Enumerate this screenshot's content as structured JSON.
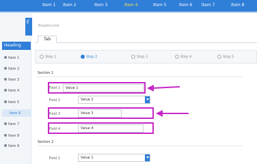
{
  "topnav": {
    "items": [
      {
        "label": "Item 1"
      },
      {
        "label": "Item 2"
      },
      {
        "label": "Item 3"
      },
      {
        "label": "Item 4"
      },
      {
        "label": "Item 5"
      },
      {
        "label": "Item 6"
      },
      {
        "label": "Item 7"
      },
      {
        "label": "Item 8"
      }
    ],
    "active_index": 3
  },
  "sidebar": {
    "tab_label": "Tab",
    "heading": "Heading",
    "items": [
      {
        "label": "Item 1"
      },
      {
        "label": "Item 2"
      },
      {
        "label": "Item 3"
      },
      {
        "label": "Item 4"
      },
      {
        "label": "Item 5"
      },
      {
        "label": "Item 6"
      },
      {
        "label": "Item 7"
      },
      {
        "label": "Item 8"
      },
      {
        "label": "Item 9"
      }
    ]
  },
  "breadcrumb": "Breadcrumb",
  "tab": {
    "label": "Tab"
  },
  "steps": [
    {
      "num": "1",
      "label": "Step 1",
      "active": false
    },
    {
      "num": "2",
      "label": "Step 2",
      "active": true
    },
    {
      "num": "3",
      "label": "Step 3",
      "active": false
    },
    {
      "num": "4",
      "label": "Step 4",
      "active": false
    },
    {
      "num": "5",
      "label": "Step 5",
      "active": false
    }
  ],
  "section1": {
    "title": "Section 1",
    "fields": [
      {
        "label": "Field 1",
        "value": "Value 1"
      },
      {
        "label": "Field 2",
        "value": "Value 2"
      },
      {
        "label": "Field 3",
        "value": "Value 3"
      },
      {
        "label": "Field 4",
        "value": "Value 4"
      }
    ]
  },
  "section2": {
    "title": "Section 2",
    "fields": [
      {
        "label": "Field 1",
        "value": "Value 1"
      }
    ]
  },
  "colors": {
    "primary": "#2f7ed8",
    "highlight": "#c628c6",
    "active_nav": "#ffe14d"
  },
  "icons": [
    "arrow-left-icon",
    "chevron-down-icon"
  ]
}
